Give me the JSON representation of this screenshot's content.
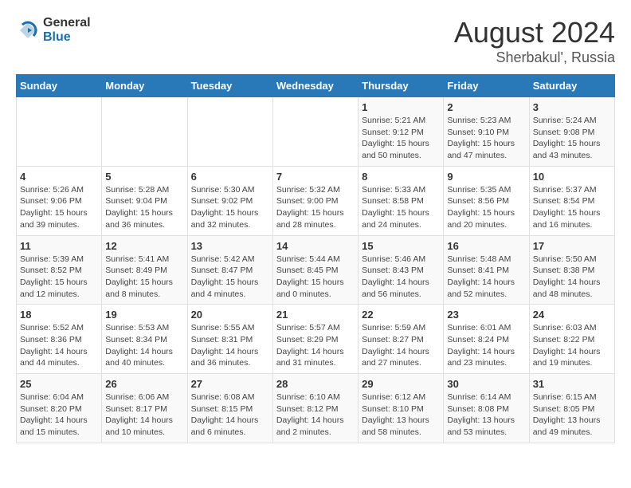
{
  "logo": {
    "general": "General",
    "blue": "Blue"
  },
  "title": {
    "month_year": "August 2024",
    "location": "Sherbakul', Russia"
  },
  "days_of_week": [
    "Sunday",
    "Monday",
    "Tuesday",
    "Wednesday",
    "Thursday",
    "Friday",
    "Saturday"
  ],
  "weeks": [
    [
      {
        "day": "",
        "info": ""
      },
      {
        "day": "",
        "info": ""
      },
      {
        "day": "",
        "info": ""
      },
      {
        "day": "",
        "info": ""
      },
      {
        "day": "1",
        "info": "Sunrise: 5:21 AM\nSunset: 9:12 PM\nDaylight: 15 hours\nand 50 minutes."
      },
      {
        "day": "2",
        "info": "Sunrise: 5:23 AM\nSunset: 9:10 PM\nDaylight: 15 hours\nand 47 minutes."
      },
      {
        "day": "3",
        "info": "Sunrise: 5:24 AM\nSunset: 9:08 PM\nDaylight: 15 hours\nand 43 minutes."
      }
    ],
    [
      {
        "day": "4",
        "info": "Sunrise: 5:26 AM\nSunset: 9:06 PM\nDaylight: 15 hours\nand 39 minutes."
      },
      {
        "day": "5",
        "info": "Sunrise: 5:28 AM\nSunset: 9:04 PM\nDaylight: 15 hours\nand 36 minutes."
      },
      {
        "day": "6",
        "info": "Sunrise: 5:30 AM\nSunset: 9:02 PM\nDaylight: 15 hours\nand 32 minutes."
      },
      {
        "day": "7",
        "info": "Sunrise: 5:32 AM\nSunset: 9:00 PM\nDaylight: 15 hours\nand 28 minutes."
      },
      {
        "day": "8",
        "info": "Sunrise: 5:33 AM\nSunset: 8:58 PM\nDaylight: 15 hours\nand 24 minutes."
      },
      {
        "day": "9",
        "info": "Sunrise: 5:35 AM\nSunset: 8:56 PM\nDaylight: 15 hours\nand 20 minutes."
      },
      {
        "day": "10",
        "info": "Sunrise: 5:37 AM\nSunset: 8:54 PM\nDaylight: 15 hours\nand 16 minutes."
      }
    ],
    [
      {
        "day": "11",
        "info": "Sunrise: 5:39 AM\nSunset: 8:52 PM\nDaylight: 15 hours\nand 12 minutes."
      },
      {
        "day": "12",
        "info": "Sunrise: 5:41 AM\nSunset: 8:49 PM\nDaylight: 15 hours\nand 8 minutes."
      },
      {
        "day": "13",
        "info": "Sunrise: 5:42 AM\nSunset: 8:47 PM\nDaylight: 15 hours\nand 4 minutes."
      },
      {
        "day": "14",
        "info": "Sunrise: 5:44 AM\nSunset: 8:45 PM\nDaylight: 15 hours\nand 0 minutes."
      },
      {
        "day": "15",
        "info": "Sunrise: 5:46 AM\nSunset: 8:43 PM\nDaylight: 14 hours\nand 56 minutes."
      },
      {
        "day": "16",
        "info": "Sunrise: 5:48 AM\nSunset: 8:41 PM\nDaylight: 14 hours\nand 52 minutes."
      },
      {
        "day": "17",
        "info": "Sunrise: 5:50 AM\nSunset: 8:38 PM\nDaylight: 14 hours\nand 48 minutes."
      }
    ],
    [
      {
        "day": "18",
        "info": "Sunrise: 5:52 AM\nSunset: 8:36 PM\nDaylight: 14 hours\nand 44 minutes."
      },
      {
        "day": "19",
        "info": "Sunrise: 5:53 AM\nSunset: 8:34 PM\nDaylight: 14 hours\nand 40 minutes."
      },
      {
        "day": "20",
        "info": "Sunrise: 5:55 AM\nSunset: 8:31 PM\nDaylight: 14 hours\nand 36 minutes."
      },
      {
        "day": "21",
        "info": "Sunrise: 5:57 AM\nSunset: 8:29 PM\nDaylight: 14 hours\nand 31 minutes."
      },
      {
        "day": "22",
        "info": "Sunrise: 5:59 AM\nSunset: 8:27 PM\nDaylight: 14 hours\nand 27 minutes."
      },
      {
        "day": "23",
        "info": "Sunrise: 6:01 AM\nSunset: 8:24 PM\nDaylight: 14 hours\nand 23 minutes."
      },
      {
        "day": "24",
        "info": "Sunrise: 6:03 AM\nSunset: 8:22 PM\nDaylight: 14 hours\nand 19 minutes."
      }
    ],
    [
      {
        "day": "25",
        "info": "Sunrise: 6:04 AM\nSunset: 8:20 PM\nDaylight: 14 hours\nand 15 minutes."
      },
      {
        "day": "26",
        "info": "Sunrise: 6:06 AM\nSunset: 8:17 PM\nDaylight: 14 hours\nand 10 minutes."
      },
      {
        "day": "27",
        "info": "Sunrise: 6:08 AM\nSunset: 8:15 PM\nDaylight: 14 hours\nand 6 minutes."
      },
      {
        "day": "28",
        "info": "Sunrise: 6:10 AM\nSunset: 8:12 PM\nDaylight: 14 hours\nand 2 minutes."
      },
      {
        "day": "29",
        "info": "Sunrise: 6:12 AM\nSunset: 8:10 PM\nDaylight: 13 hours\nand 58 minutes."
      },
      {
        "day": "30",
        "info": "Sunrise: 6:14 AM\nSunset: 8:08 PM\nDaylight: 13 hours\nand 53 minutes."
      },
      {
        "day": "31",
        "info": "Sunrise: 6:15 AM\nSunset: 8:05 PM\nDaylight: 13 hours\nand 49 minutes."
      }
    ]
  ]
}
